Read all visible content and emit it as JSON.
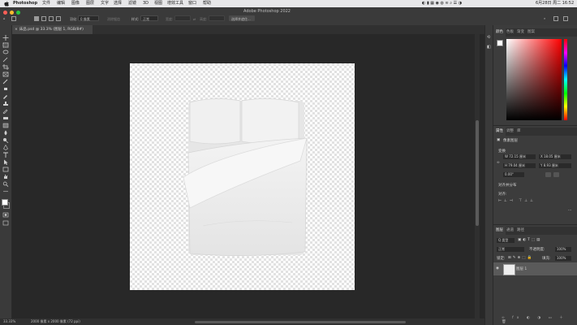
{
  "menubar": {
    "app_name": "Photoshop",
    "items": [
      "文件",
      "编辑",
      "图像",
      "图层",
      "文字",
      "选择",
      "滤镜",
      "3D",
      "视图",
      "增效工具",
      "窗口",
      "帮助"
    ],
    "datetime": "6月28日 周二 16:52"
  },
  "window": {
    "title": "Adobe Photoshop 2022"
  },
  "options": {
    "feather_label": "羽化:",
    "feather_value": "0 像素",
    "antialias": "消除锯齿",
    "style_label": "样式:",
    "style_value": "正常",
    "width_label": "宽度:",
    "height_label": "高度:",
    "select_mask_button": "选择并遮住..."
  },
  "document": {
    "tab_label": "床品.psd @ 33.3% (图层 1, RGB/8#)"
  },
  "status": {
    "zoom": "33.33%",
    "dims": "2000 像素 x 2000 像素 (72 ppi)"
  },
  "color_panel": {
    "tabs": [
      "颜色",
      "色板",
      "渐变",
      "图案"
    ],
    "fg": "#ffffff",
    "bg": "#000000"
  },
  "properties_panel": {
    "tabs": [
      "属性",
      "调整",
      "库"
    ],
    "layer_kind": "像素图层",
    "transform_label": "变换",
    "w_value": "W 72.15 厘米",
    "x_value": "X 18.05 厘米",
    "h_value": "H 79.04 厘米",
    "y_value": "Y 8.93 厘米",
    "angle_value": "0.00°",
    "align_label": "对齐并分布",
    "align_sub": "对齐:"
  },
  "layers_panel": {
    "tabs": [
      "图层",
      "通道",
      "路径"
    ],
    "filter_label": "Q 类型",
    "blend_mode": "正常",
    "opacity_label": "不透明度:",
    "opacity_value": "100%",
    "lock_label": "锁定:",
    "fill_label": "填充:",
    "fill_value": "100%",
    "layers": [
      {
        "name": "图层 1",
        "visible": true
      }
    ]
  }
}
